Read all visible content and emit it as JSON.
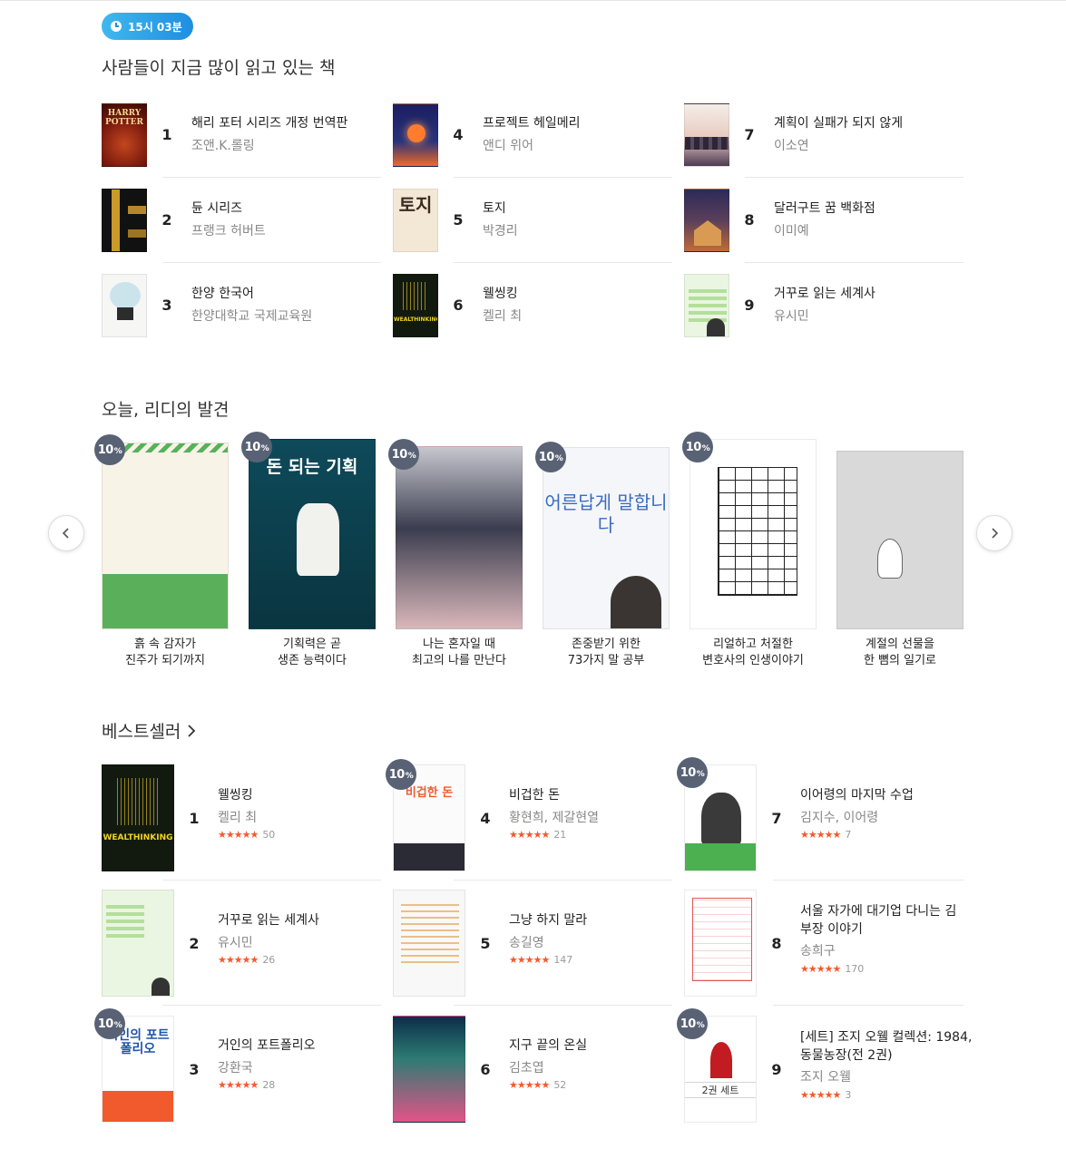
{
  "time_badge": "15시 03분",
  "popular": {
    "title": "사람들이 지금 많이 읽고 있는 책",
    "items": [
      {
        "rank": "1",
        "title": "해리 포터 시리즈 개정 번역판",
        "author": "조앤.K.롤링",
        "cover_text": "HARRY POTTER"
      },
      {
        "rank": "2",
        "title": "듄 시리즈",
        "author": "프랭크 허버트"
      },
      {
        "rank": "3",
        "title": "한양 한국어",
        "author": "한양대학교 국제교육원"
      },
      {
        "rank": "4",
        "title": "프로젝트 헤일메리",
        "author": "앤디 위어"
      },
      {
        "rank": "5",
        "title": "토지",
        "author": "박경리",
        "cover_text": "토지"
      },
      {
        "rank": "6",
        "title": "웰씽킹",
        "author": "켈리 최",
        "cover_text": "WEALTHINKING"
      },
      {
        "rank": "7",
        "title": "계획이 실패가 되지 않게",
        "author": "이소연"
      },
      {
        "rank": "8",
        "title": "달러구트 꿈 백화점",
        "author": "이미예"
      },
      {
        "rank": "9",
        "title": "거꾸로 읽는 세계사",
        "author": "유시민"
      }
    ]
  },
  "discovery": {
    "title": "오늘, 리디의 발견",
    "discount": "10",
    "discount_unit": "%",
    "items": [
      {
        "line1": "흙 속 감자가",
        "line2": "진주가 되기까지"
      },
      {
        "line1": "기획력은 곧",
        "line2": "생존 능력이다",
        "cover_text": "돈 되는 기획"
      },
      {
        "line1": "나는 혼자일 때",
        "line2": "최고의 나를 만난다"
      },
      {
        "line1": "존중받기 위한",
        "line2": "73가지 말 공부",
        "cover_text": "어른답게 말합니다"
      },
      {
        "line1": "리얼하고 처절한",
        "line2": "변호사의 인생이야기"
      },
      {
        "line1": "계절의 선물을",
        "line2": "한 뼘의 일기로"
      }
    ],
    "prev_icon": "chevron-left-icon",
    "next_icon": "chevron-right-icon"
  },
  "bestseller": {
    "title": "베스트셀러",
    "items": [
      {
        "rank": "1",
        "title_line1": "웰씽킹",
        "title_line2": "",
        "author": "켈리 최",
        "reviews": "50",
        "cover_text": "WEALTHINKING"
      },
      {
        "rank": "2",
        "title_line1": "거꾸로 읽는 세계사",
        "title_line2": "",
        "author": "유시민",
        "reviews": "26"
      },
      {
        "rank": "3",
        "title_line1": "거인의 포트폴리오",
        "title_line2": "",
        "author": "강환국",
        "reviews": "28",
        "cover_text": "거인의 포트폴리오"
      },
      {
        "rank": "4",
        "title_line1": "비겁한 돈",
        "title_line2": "",
        "author": "황현희, 제갈현열",
        "reviews": "21",
        "cover_text": "비겁한 돈"
      },
      {
        "rank": "5",
        "title_line1": "그냥 하지 말라",
        "title_line2": "",
        "author": "송길영",
        "reviews": "147"
      },
      {
        "rank": "6",
        "title_line1": "지구 끝의 온실",
        "title_line2": "",
        "author": "김초엽",
        "reviews": "52"
      },
      {
        "rank": "7",
        "title_line1": "이어령의 마지막 수업",
        "title_line2": "",
        "author": "김지수, 이어령",
        "reviews": "7"
      },
      {
        "rank": "8",
        "title_line1": "서울 자가에 대기업 다니는 김",
        "title_line2": "부장 이야기",
        "author": "송희구",
        "reviews": "170"
      },
      {
        "rank": "9",
        "title_line1": "[세트] 조지 오웰 컬렉션: 1984,",
        "title_line2": "동물농장(전 2권)",
        "author": "조지 오웰",
        "reviews": "3",
        "set_tag": "2권 세트"
      }
    ],
    "stars": "★★★★★"
  }
}
